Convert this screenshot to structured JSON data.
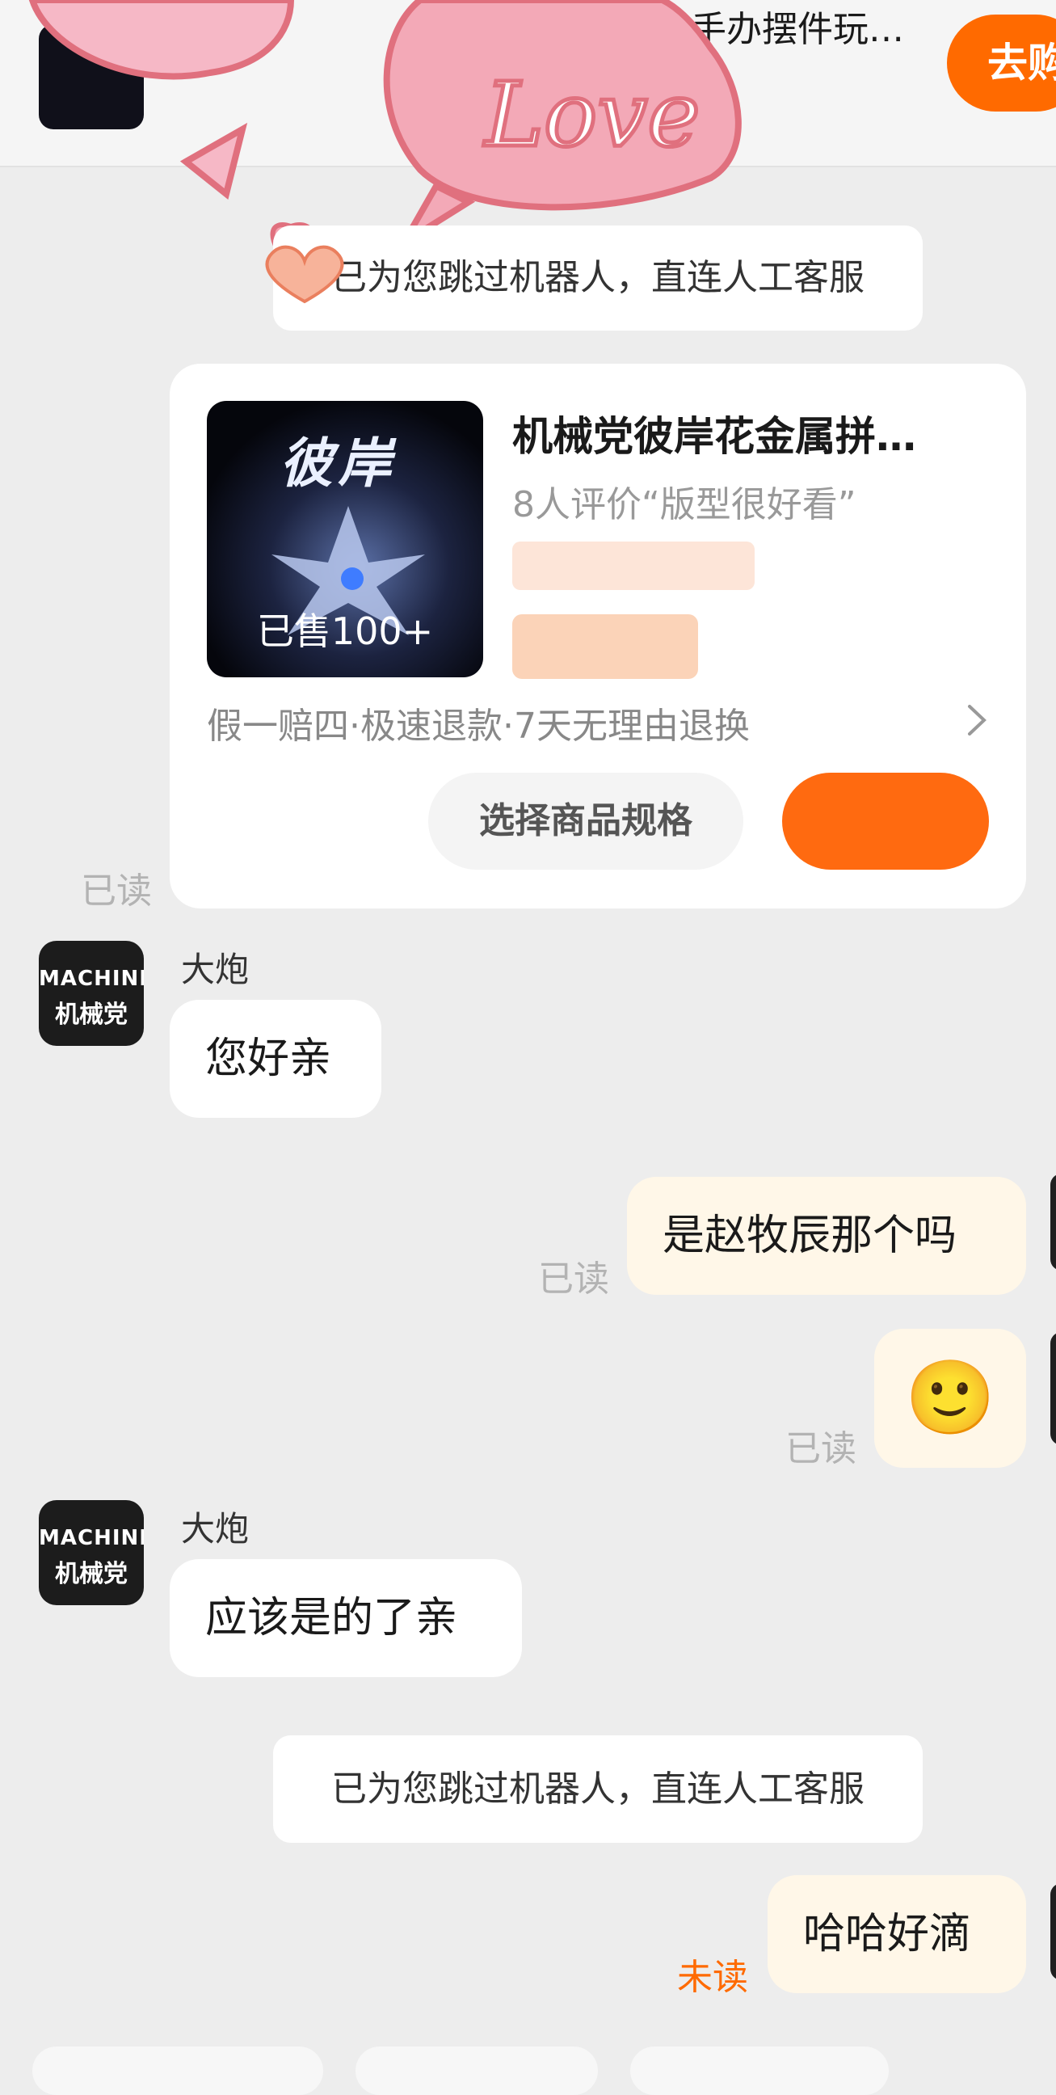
{
  "top_product": {
    "title": "手办摆件玩…",
    "buy_label": "去购"
  },
  "notices": [
    "已为您跳过机器人，直连人工客服",
    "已为您跳过机器人，直连人工客服"
  ],
  "product_card": {
    "image_title": "彼岸",
    "image_sold": "已售100+",
    "title": "机械党彼岸花金属拼…",
    "review": "8人评价“版型很好看”",
    "guarantee": "假一赔四·极速退款·7天无理由退换",
    "spec_button": "选择商品规格",
    "status": "已读"
  },
  "messages": [
    {
      "sender": "大炮",
      "avatar_line1": "MACHINE",
      "avatar_line2": "机械党",
      "text": "您好亲"
    },
    {
      "text": "是赵牧辰那个吗",
      "status": "已读"
    },
    {
      "text": "🙂",
      "status": "已读"
    },
    {
      "sender": "大炮",
      "avatar_line1": "MACHINE",
      "avatar_line2": "机械党",
      "text": "应该是的了亲"
    },
    {
      "text": "哈哈好滴",
      "status": "未读"
    }
  ],
  "colors": {
    "accent": "#ff6a00",
    "background": "#ededed",
    "outgoing_bubble": "#fff7e8",
    "incoming_bubble": "#ffffff",
    "read_status": "#b3b3b3"
  },
  "icons": [
    "love-sticker",
    "chevron-right-icon",
    "smiley-emoji"
  ]
}
